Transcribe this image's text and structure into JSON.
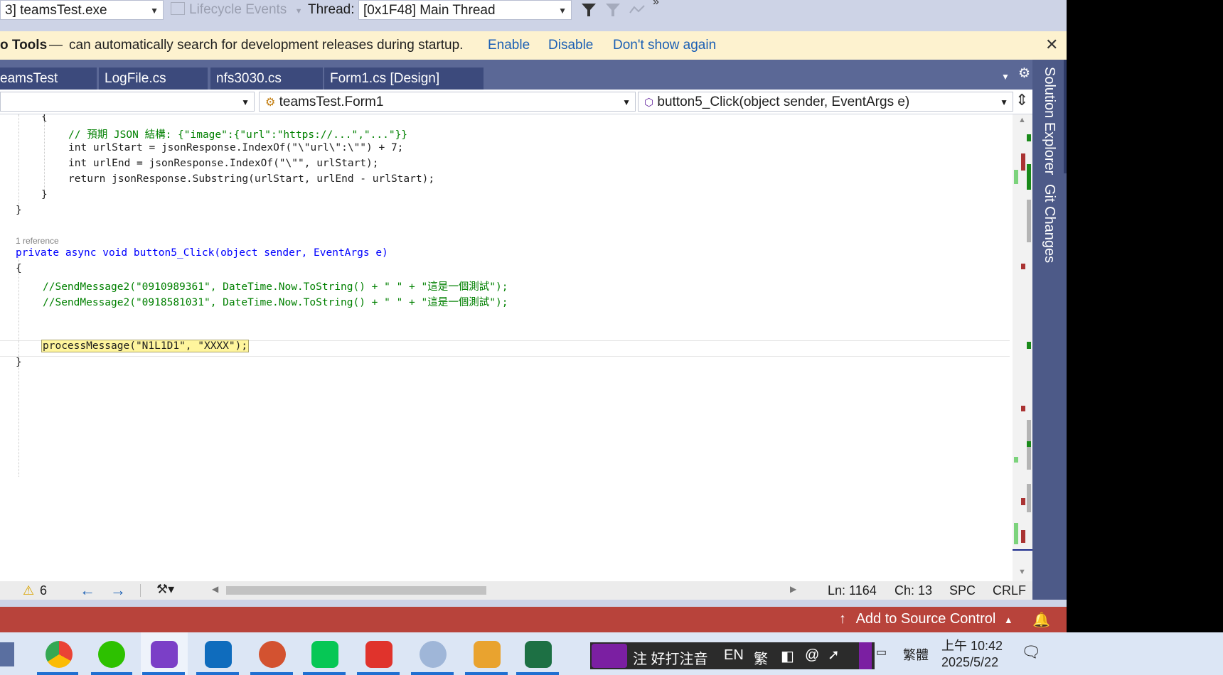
{
  "debug_toolbar": {
    "process": "3] teamsTest.exe",
    "lifecycle": "Lifecycle Events",
    "thread_label": "Thread:",
    "thread_value": "[0x1F48] Main Thread"
  },
  "infobar": {
    "title": "o Tools",
    "dash": "—",
    "message": "can automatically search for development releases during startup.",
    "links": [
      "Enable",
      "Disable",
      "Don't show again"
    ]
  },
  "tabs": [
    "eamsTest",
    "LogFile.cs",
    "nfs3030.cs",
    "Form1.cs [Design]"
  ],
  "navbar": {
    "class_combo": "teamsTest.Form1",
    "member_combo": "button5_Click(object sender, EventArgs e)"
  },
  "code": {
    "brace_open_1": "{",
    "comment_json": "// 預期 JSON 結構: {\"image\":{\"url\":\"https://...\",\"...\"}}",
    "line_urlstart": "int urlStart = jsonResponse.IndexOf(\"\\\"url\\\":\\\"\") + 7;",
    "line_urlend": "int urlEnd = jsonResponse.IndexOf(\"\\\"\", urlStart);",
    "line_return": "return jsonResponse.Substring(urlStart, urlEnd - urlStart);",
    "brace_close_inner": "}",
    "brace_close_outer": "}",
    "reference": "1 reference",
    "method_sig": "private async void button5_Click(object sender, EventArgs e)",
    "brace_open_2": "{",
    "comment_send1": "//SendMessage2(\"0910989361\", DateTime.Now.ToString() + \" \" + \"這是一個測試\");",
    "comment_send2": "//SendMessage2(\"0918581031\", DateTime.Now.ToString() + \" \" + \"這是一個測試\");",
    "process_call": "processMessage(\"N1L1D1\", \"XXXX\");",
    "brace_close_2": "}"
  },
  "side_panel": {
    "solution_explorer": "Solution Explorer",
    "git_changes": "Git Changes"
  },
  "statusbar": {
    "warnings": "6",
    "line": "Ln: 1164",
    "col": "Ch: 13",
    "spacing": "SPC",
    "eol": "CRLF"
  },
  "sourcebar": {
    "add_source": "Add to Source Control"
  },
  "taskbar": {
    "ime": "注 好打注音",
    "lang": "EN",
    "trad": "繁",
    "trad_label": "繁體",
    "time": "上午 10:42",
    "date": "2025/5/22"
  },
  "colors": {
    "accent": "#1a5fb4",
    "tab_active": "#3c4a7c",
    "source_bar": "#b8433b",
    "highlight": "#fff59d"
  }
}
